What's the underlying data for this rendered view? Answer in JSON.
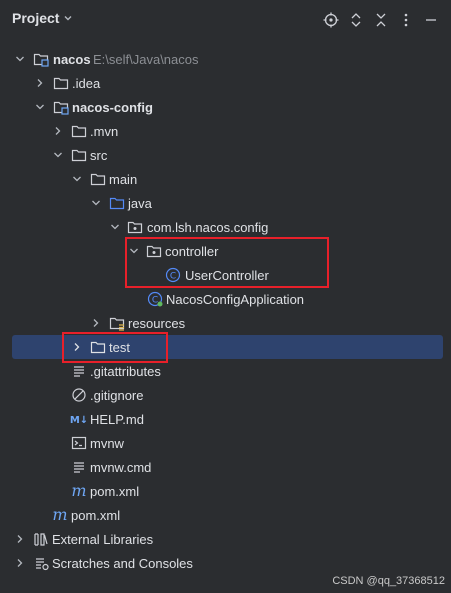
{
  "panel": {
    "title": "Project"
  },
  "tree": {
    "root_name": "nacos",
    "root_path": "E:\\self\\Java\\nacos",
    "idea": ".idea",
    "nacos_config": "nacos-config",
    "mvn": ".mvn",
    "src": "src",
    "main": "main",
    "java": "java",
    "package": "com.lsh.nacos.config",
    "controller": "controller",
    "user_controller": "UserController",
    "app": "NacosConfigApplication",
    "resources": "resources",
    "test": "test",
    "gitattributes": ".gitattributes",
    "gitignore": ".gitignore",
    "help": "HELP.md",
    "mvnw": "mvnw",
    "mvnw_cmd": "mvnw.cmd",
    "pom_inner": "pom.xml",
    "pom_root": "pom.xml",
    "external_libraries": "External Libraries",
    "scratches": "Scratches and Consoles"
  },
  "icons": {
    "m_letter": "m",
    "class_letter": "C",
    "markdown_letter": "M↓"
  },
  "colors": {
    "background": "#2b2d30",
    "selection": "#2e436e",
    "highlight_box": "#e8202a",
    "folder_source": "#548af7"
  },
  "watermark": "CSDN @qq_37368512"
}
